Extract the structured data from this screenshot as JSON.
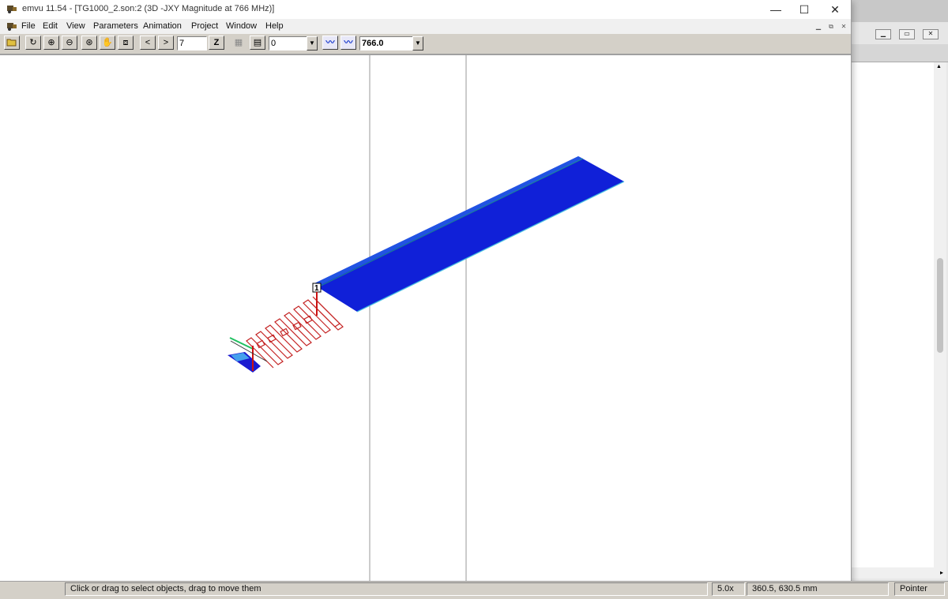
{
  "window": {
    "app_title": "emvu 11.54 - [TG1000_2.son:2 (3D -JXY Magnitude at 766 MHz)]",
    "minimize": "—",
    "maximize": "☐",
    "close": "✕"
  },
  "menu": {
    "items": [
      "File",
      "Edit",
      "View",
      "Parameters",
      "Animation",
      "Project",
      "Window",
      "Help"
    ]
  },
  "toolbar": {
    "frame_value": "7",
    "z_label": "Z",
    "level_value": "0",
    "frequency_value": "766.0",
    "prev_label": "<",
    "next_label": ">"
  },
  "canvas": {
    "port_label": "1"
  },
  "status": {
    "message": "Click or drag to select objects, drag to move them",
    "zoom": "5.0x",
    "coords": "360.5, 630.5 mm",
    "mode": "Pointer"
  },
  "colors": {
    "current_high": "#0d2fd6",
    "current_low": "#1a1ad0",
    "meander": "#c42222",
    "port_probe": "#cc1111"
  }
}
